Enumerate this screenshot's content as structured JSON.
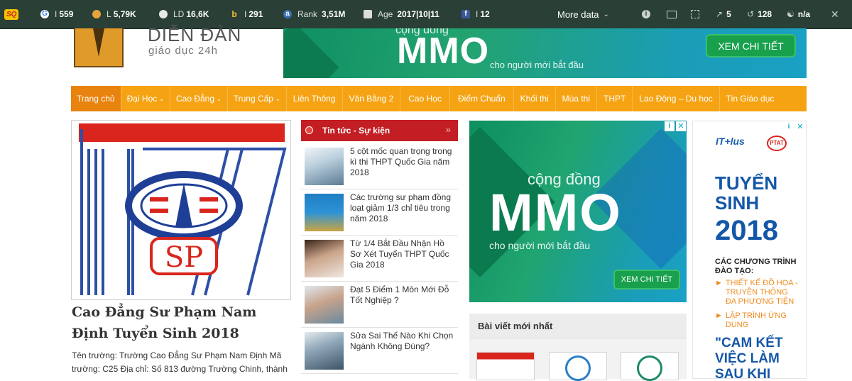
{
  "toolbar": {
    "logo": "SQ",
    "items": [
      {
        "icon": "google-icon",
        "label": "I",
        "value": "559"
      },
      {
        "icon": "link-icon",
        "label": "L",
        "value": "5,79K"
      },
      {
        "icon": "link-domain-icon",
        "label": "LD",
        "value": "16,6K"
      },
      {
        "icon": "bing-icon",
        "label": "I",
        "value": "291"
      },
      {
        "icon": "alexa-icon",
        "label": "Rank",
        "value": "3,51M"
      },
      {
        "icon": "calendar-icon",
        "label": "Age",
        "value": "2017|10|11"
      },
      {
        "icon": "facebook-icon",
        "label": "I",
        "value": "12"
      }
    ],
    "more_data": "More data",
    "right": [
      {
        "icon": "info-icon",
        "value": ""
      },
      {
        "icon": "monitor-icon",
        "value": ""
      },
      {
        "icon": "expand-icon",
        "value": ""
      },
      {
        "icon": "external-links-icon",
        "value": "5"
      },
      {
        "icon": "internal-links-icon",
        "value": "128"
      },
      {
        "icon": "robot-icon",
        "value": "n/a"
      }
    ]
  },
  "logo": {
    "line1": "DIỄN ĐÀN",
    "line2": "giáo dục 24h"
  },
  "banner_top": {
    "small": "cộng đồng",
    "big": "MMO",
    "tagline": "cho người mới bắt đầu",
    "cta": "XEM CHI TIẾT"
  },
  "nav": [
    {
      "label": "Trang chủ",
      "dropdown": false
    },
    {
      "label": "Đại Học",
      "dropdown": true
    },
    {
      "label": "Cao Đẳng",
      "dropdown": true
    },
    {
      "label": "Trung Cấp",
      "dropdown": true
    },
    {
      "label": "Liên Thông",
      "dropdown": false
    },
    {
      "label": "Văn Bằng 2",
      "dropdown": false
    },
    {
      "label": "Cao Học",
      "dropdown": false
    },
    {
      "label": "Điểm Chuẩn",
      "dropdown": false
    },
    {
      "label": "Khối thi",
      "dropdown": false
    },
    {
      "label": "Mùa thi",
      "dropdown": false
    },
    {
      "label": "THPT",
      "dropdown": false
    },
    {
      "label": "Lao Động – Du học",
      "dropdown": false
    },
    {
      "label": "Tin Giáo dục",
      "dropdown": false
    }
  ],
  "featured": {
    "title": "Cao Đẳng Sư Phạm Nam Định Tuyển Sinh 2018",
    "excerpt": "Tên trường: Trường Cao Đẳng Sư Phạm Nam Định Mã trường: C25 Địa chỉ: Số 813 đường Trường Chinh, thành",
    "logo_letters": "SP"
  },
  "news": {
    "heading": "Tin tức - Sự kiện",
    "items": [
      "5 cột mốc quan trọng trong kì thi THPT Quốc Gia năm 2018",
      "Các trường sư phạm đồng loạt giảm 1/3 chỉ tiêu trong năm 2018",
      "Từ 1/4 Bắt Đầu Nhận Hồ Sơ Xét Tuyển THPT Quốc Gia 2018",
      "Đạt 5 Điểm 1 Môn Mới Đỗ Tốt Nghiệp ?",
      "Sửa Sai Thế Nào Khi Chọn Ngành Không Đúng?"
    ]
  },
  "ad_mid": {
    "small": "cộng đồng",
    "big": "MMO",
    "tagline": "cho người mới bắt đầu",
    "cta": "XEM CHI TIẾT"
  },
  "ad_right": {
    "brand1": "IT+lus",
    "brand2": "PTAT",
    "headline1": "TUYỂN",
    "headline2": "SINH",
    "year": "2018",
    "programs_title": "CÁC CHƯƠNG TRÌNH ĐÀO TẠO:",
    "program1": "THIẾT KẾ ĐỒ HỌA - TRUYỀN THÔNG ĐA PHƯƠNG TIỆN",
    "program2": "LẬP TRÌNH ỨNG DỤNG",
    "commit": "\"CAM KẾT VIỆC LÀM SAU KHI"
  },
  "latest": {
    "heading": "Bài viết mới nhất"
  },
  "colors": {
    "toolbar": "#2a3f36",
    "nav": "#f6a313",
    "nav_active": "#e8830d",
    "news_head": "#c31e24",
    "ad_green": "#1d9f6e",
    "ad_blue": "#1457a8"
  }
}
